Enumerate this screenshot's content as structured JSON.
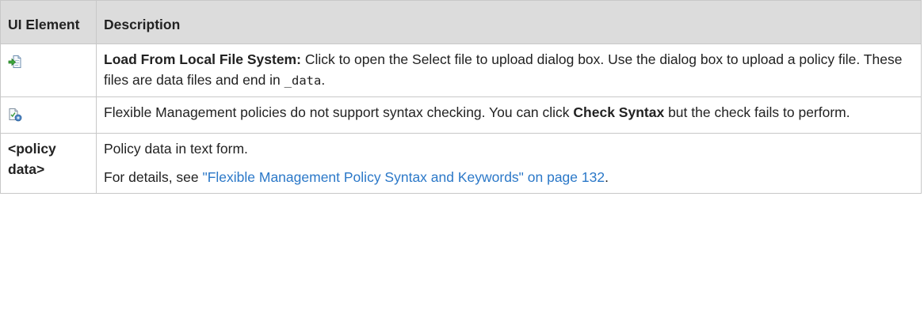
{
  "table": {
    "headers": {
      "element": "UI Element",
      "description": "Description"
    },
    "rows": [
      {
        "icon": "load-from-file-icon",
        "bold_label": "Load From Local File System:",
        "text": " Click to open the Select file to upload dialog box. Use the dialog box to upload a policy file. These files are data files and end in ",
        "code": "_data",
        "end": "."
      },
      {
        "icon": "check-syntax-icon",
        "text_a": "Flexible Management policies do not support syntax checking. You can click ",
        "bold": "Check Syntax",
        "text_b": " but the check fails to perform."
      },
      {
        "element": "<policy data>",
        "para1": "Policy data in text form.",
        "para2_prefix": "For details, see ",
        "link": "\"Flexible Management Policy Syntax and Keywords\" on page 132",
        "para2_end": "."
      }
    ]
  },
  "colors": {
    "header_bg": "#dcdcdc",
    "border": "#c8c8c8",
    "link": "#2b78c8"
  }
}
